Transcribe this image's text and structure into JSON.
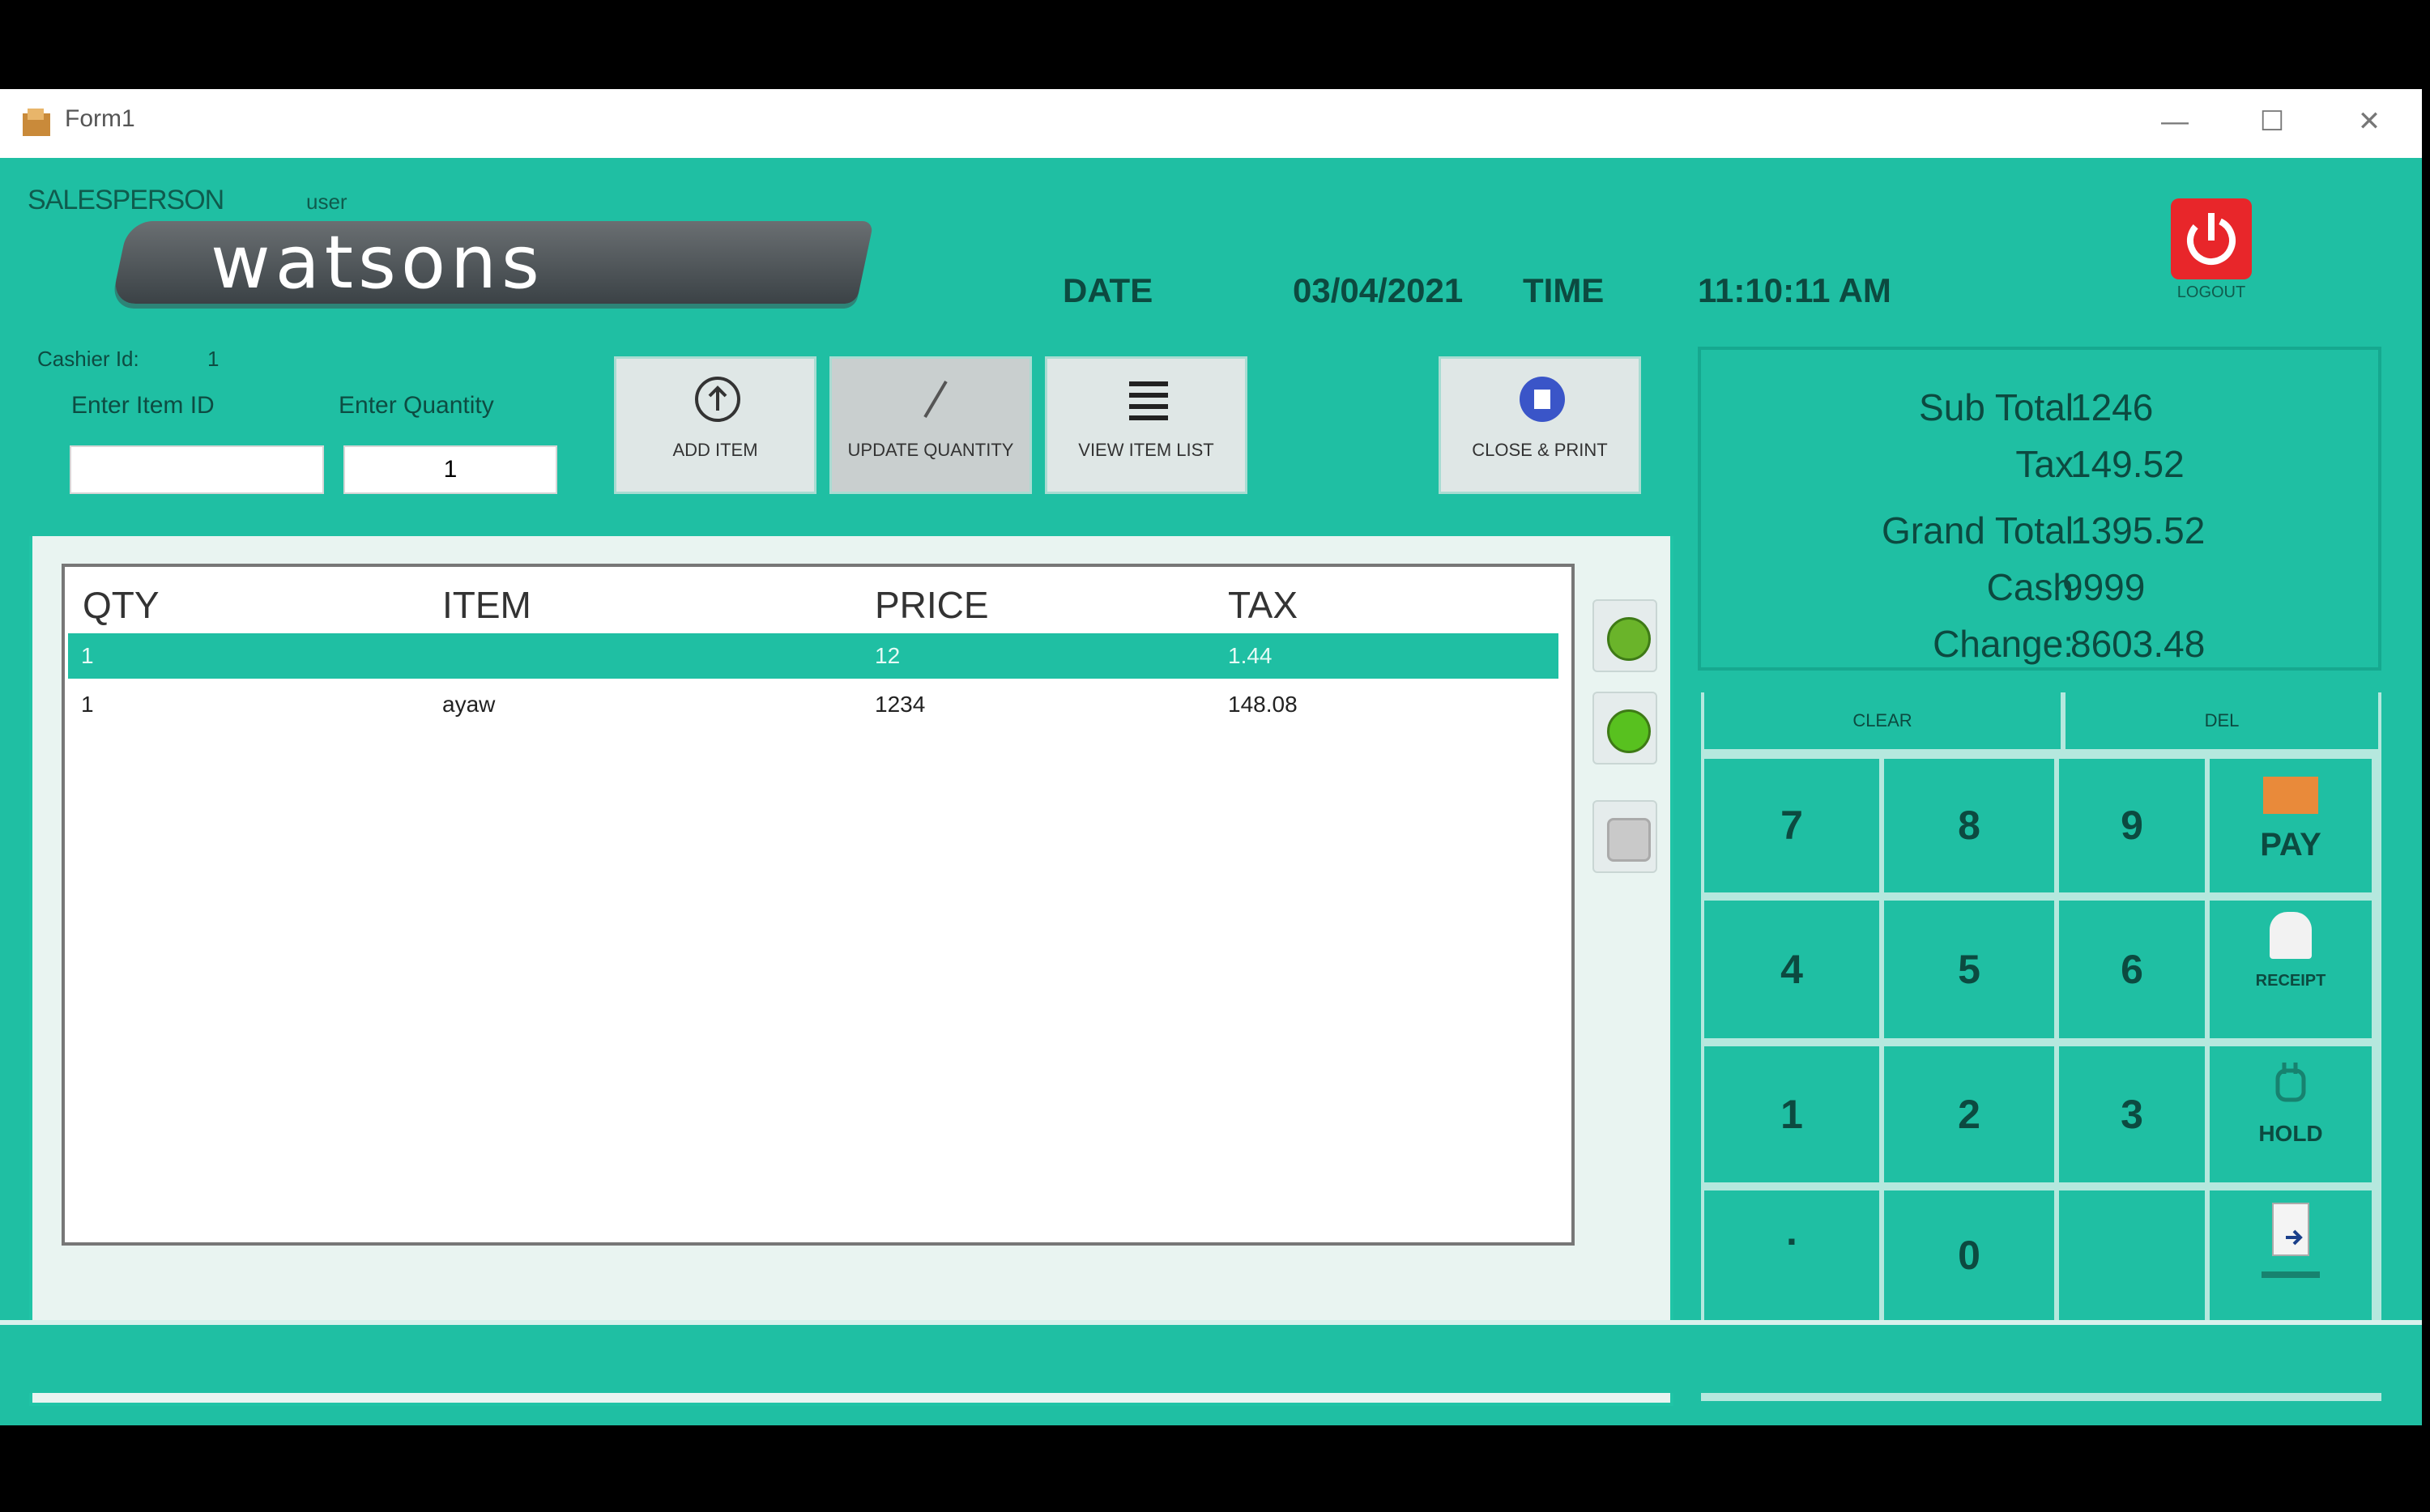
{
  "window": {
    "title": "Form1",
    "minimize": "—",
    "maximize": "☐",
    "close": "✕"
  },
  "header": {
    "salesperson_label": "SALESPERSON",
    "salesperson_name": "user",
    "logo_text": "watsons",
    "date_label": "DATE",
    "date_value": "03/04/2021",
    "time_label": "TIME",
    "time_value": "11:10:11 AM",
    "logout_label": "LOGOUT"
  },
  "entry": {
    "cashier_label": "Cashier Id:",
    "cashier_value": "1",
    "item_id_label": "Enter Item ID",
    "item_id_value": "",
    "quantity_label": "Enter Quantity",
    "quantity_value": "1"
  },
  "toolbar": {
    "add_item": "ADD ITEM",
    "update_quantity": "UPDATE QUANTITY",
    "item_list": "VIEW ITEM LIST",
    "close_print": "CLOSE & PRINT"
  },
  "table": {
    "headers": [
      "QTY",
      "ITEM",
      "PRICE",
      "TAX"
    ],
    "rows": [
      {
        "qty": "1",
        "item": "",
        "price": "12",
        "tax": "1.44"
      },
      {
        "qty": "1",
        "item": "ayaw",
        "price": "1234",
        "tax": "148.08"
      }
    ]
  },
  "totals": {
    "sub_total_label": "Sub Total",
    "sub_total_value": "1246",
    "tax_label": "Tax",
    "tax_value": "149.52",
    "grand_total_label": "Grand Total",
    "grand_total_value": "1395.52",
    "cash_label": "Cash",
    "cash_value": "9999",
    "change_label": "Change:",
    "change_value": "8603.48"
  },
  "keypad": {
    "clear": "CLEAR",
    "del": "DEL",
    "keys": [
      "7",
      "8",
      "9",
      "4",
      "5",
      "6",
      "1",
      "2",
      "3",
      ".",
      "0",
      ""
    ],
    "pay": "PAY",
    "receipt": "RECEIPT",
    "hold": "HOLD",
    "exit": ""
  },
  "colors": {
    "accent": "#1fbfa3",
    "logout": "#e8262a"
  }
}
